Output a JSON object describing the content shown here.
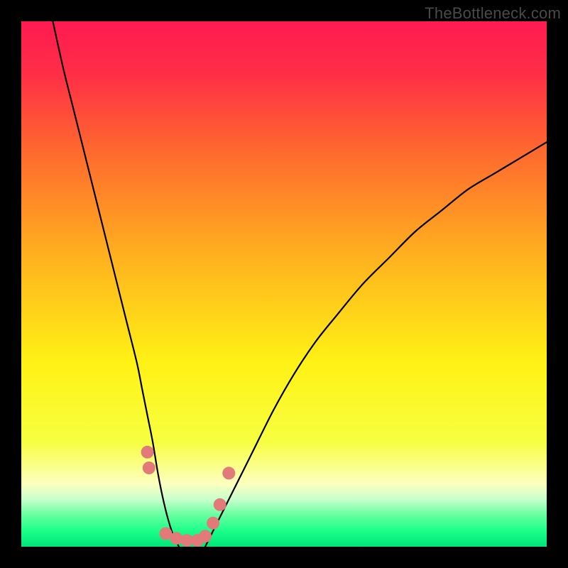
{
  "watermark": "TheBottleneck.com",
  "chart_data": {
    "type": "line",
    "title": "",
    "xlabel": "",
    "ylabel": "",
    "xlim": [
      0,
      100
    ],
    "ylim": [
      0,
      100
    ],
    "grid": false,
    "legend": false,
    "background_gradient": {
      "stops": [
        {
          "offset": 0.0,
          "color": "#ff1a52"
        },
        {
          "offset": 0.1,
          "color": "#ff2e46"
        },
        {
          "offset": 0.25,
          "color": "#ff6a2e"
        },
        {
          "offset": 0.45,
          "color": "#ffb21e"
        },
        {
          "offset": 0.65,
          "color": "#fff215"
        },
        {
          "offset": 0.8,
          "color": "#f7ff40"
        },
        {
          "offset": 0.88,
          "color": "#fdffbf"
        },
        {
          "offset": 0.91,
          "color": "#c8ffcb"
        },
        {
          "offset": 0.94,
          "color": "#66ff9f"
        },
        {
          "offset": 0.97,
          "color": "#1bff89"
        },
        {
          "offset": 1.0,
          "color": "#00e57a"
        }
      ]
    },
    "series": [
      {
        "name": "curve-left",
        "color": "#000000",
        "x": [
          6,
          8,
          10,
          12,
          14,
          16,
          18,
          20,
          22,
          23,
          24,
          25,
          26,
          27,
          28,
          29,
          30
        ],
        "y": [
          100,
          91,
          83,
          75,
          67,
          59,
          51,
          43,
          35,
          30,
          25,
          20,
          14,
          9,
          5,
          2,
          0
        ]
      },
      {
        "name": "curve-right",
        "color": "#000000",
        "x": [
          35,
          37,
          40,
          44,
          48,
          52,
          56,
          60,
          65,
          70,
          75,
          80,
          85,
          90,
          95,
          100
        ],
        "y": [
          0,
          4,
          10,
          18,
          26,
          33,
          39,
          44,
          50,
          55,
          60,
          64,
          68,
          71,
          74,
          77
        ]
      }
    ],
    "markers": {
      "name": "dot-cluster",
      "color": "#e37a7a",
      "radius": 9,
      "points": [
        {
          "x": 24.0,
          "y": 18.0
        },
        {
          "x": 24.3,
          "y": 15.0
        },
        {
          "x": 27.5,
          "y": 2.5
        },
        {
          "x": 29.5,
          "y": 1.6
        },
        {
          "x": 31.5,
          "y": 1.2
        },
        {
          "x": 33.5,
          "y": 1.2
        },
        {
          "x": 35.0,
          "y": 2.0
        },
        {
          "x": 36.5,
          "y": 4.5
        },
        {
          "x": 37.8,
          "y": 8.0
        },
        {
          "x": 39.5,
          "y": 14.0
        }
      ]
    }
  }
}
